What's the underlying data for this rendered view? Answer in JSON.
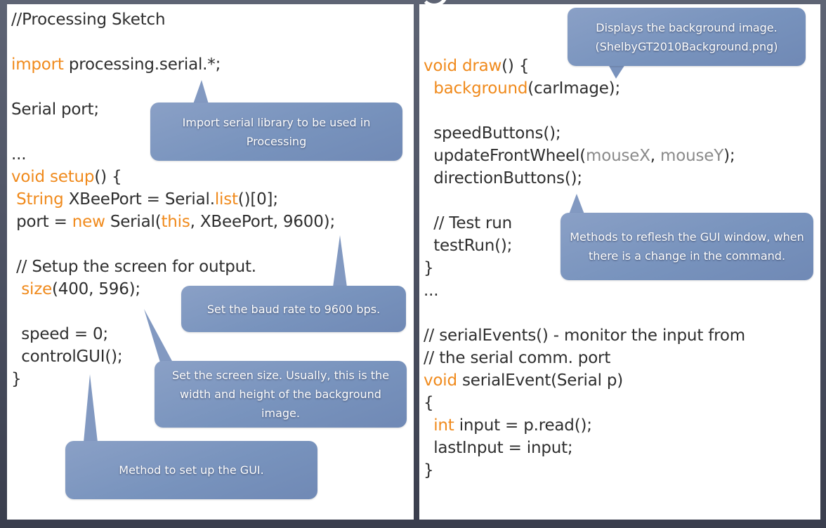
{
  "slide": {
    "colors": {
      "background": "#4c5162",
      "panel": "#ffffff",
      "code_text": "#2e2e2e",
      "keyword": "#f08a1c",
      "builtin_variable": "#8a8a8a",
      "callout_fill": "#7893bd",
      "callout_text": "#ffffff"
    }
  },
  "left_panel": {
    "lines": [
      [
        {
          "t": "//Processing Sketch",
          "c": "plain"
        }
      ],
      [
        {
          "t": "",
          "c": "plain"
        }
      ],
      [
        {
          "t": "import",
          "c": "kw"
        },
        {
          "t": " processing.serial.*;",
          "c": "plain"
        }
      ],
      [
        {
          "t": "",
          "c": "plain"
        }
      ],
      [
        {
          "t": "Serial port;",
          "c": "plain"
        }
      ],
      [
        {
          "t": "",
          "c": "plain"
        }
      ],
      [
        {
          "t": "...",
          "c": "plain"
        }
      ],
      [
        {
          "t": "void setup",
          "c": "kw"
        },
        {
          "t": "() {",
          "c": "plain"
        }
      ],
      [
        {
          "t": " ",
          "c": "plain"
        },
        {
          "t": "String",
          "c": "kw"
        },
        {
          "t": " XBeePort = Serial.",
          "c": "plain"
        },
        {
          "t": "list",
          "c": "kw"
        },
        {
          "t": "()[0];",
          "c": "plain"
        }
      ],
      [
        {
          "t": " port = ",
          "c": "plain"
        },
        {
          "t": "new",
          "c": "kw"
        },
        {
          "t": " Serial(",
          "c": "plain"
        },
        {
          "t": "this",
          "c": "kw"
        },
        {
          "t": ", XBeePort, 9600);",
          "c": "plain"
        }
      ],
      [
        {
          "t": "",
          "c": "plain"
        }
      ],
      [
        {
          "t": " // Setup the screen for output.",
          "c": "plain"
        }
      ],
      [
        {
          "t": "  ",
          "c": "plain"
        },
        {
          "t": "size",
          "c": "kw"
        },
        {
          "t": "(400, 596);",
          "c": "plain"
        }
      ],
      [
        {
          "t": "",
          "c": "plain"
        }
      ],
      [
        {
          "t": "  speed = 0;",
          "c": "plain"
        }
      ],
      [
        {
          "t": "  controlGUI();",
          "c": "plain"
        }
      ],
      [
        {
          "t": "}",
          "c": "plain"
        }
      ]
    ]
  },
  "right_panel": {
    "lines": [
      [
        {
          "t": "",
          "c": "plain"
        }
      ],
      [
        {
          "t": "",
          "c": "plain"
        }
      ],
      [
        {
          "t": "void draw",
          "c": "kw"
        },
        {
          "t": "() {",
          "c": "plain"
        }
      ],
      [
        {
          "t": "  ",
          "c": "plain"
        },
        {
          "t": "background",
          "c": "kw"
        },
        {
          "t": "(carImage);",
          "c": "plain"
        }
      ],
      [
        {
          "t": "",
          "c": "plain"
        }
      ],
      [
        {
          "t": "  speedButtons();",
          "c": "plain"
        }
      ],
      [
        {
          "t": "  updateFrontWheel(",
          "c": "plain"
        },
        {
          "t": "mouseX",
          "c": "var"
        },
        {
          "t": ", ",
          "c": "plain"
        },
        {
          "t": "mouseY",
          "c": "var"
        },
        {
          "t": ");",
          "c": "plain"
        }
      ],
      [
        {
          "t": "  directionButtons();",
          "c": "plain"
        }
      ],
      [
        {
          "t": "",
          "c": "plain"
        }
      ],
      [
        {
          "t": "  // Test run",
          "c": "plain"
        }
      ],
      [
        {
          "t": "  testRun();",
          "c": "plain"
        }
      ],
      [
        {
          "t": "}",
          "c": "plain"
        }
      ],
      [
        {
          "t": "...",
          "c": "plain"
        }
      ],
      [
        {
          "t": "",
          "c": "plain"
        }
      ],
      [
        {
          "t": "// serialEvents() - monitor the input from",
          "c": "plain"
        }
      ],
      [
        {
          "t": "// the serial comm. port",
          "c": "plain"
        }
      ],
      [
        {
          "t": "void",
          "c": "kw"
        },
        {
          "t": " serialEvent(Serial p)",
          "c": "plain"
        }
      ],
      [
        {
          "t": "{",
          "c": "plain"
        }
      ],
      [
        {
          "t": "  ",
          "c": "plain"
        },
        {
          "t": "int",
          "c": "kw"
        },
        {
          "t": " input = p.read();",
          "c": "plain"
        }
      ],
      [
        {
          "t": "  lastInput = input;",
          "c": "plain"
        }
      ],
      [
        {
          "t": "}",
          "c": "plain"
        }
      ]
    ]
  },
  "callouts": {
    "import_serial": "Import serial library to be used in Processing",
    "baud_rate": "Set the baud rate to 9600 bps.",
    "screen_size": "Set the screen size. Usually, this is the width and height of the background image.",
    "setup_gui": "Method to set up the GUI.",
    "background_image": "Displays the background image. (ShelbyGT2010Background.png)",
    "refresh_gui": "Methods to reflesh the GUI window, when there is a change in the command."
  }
}
